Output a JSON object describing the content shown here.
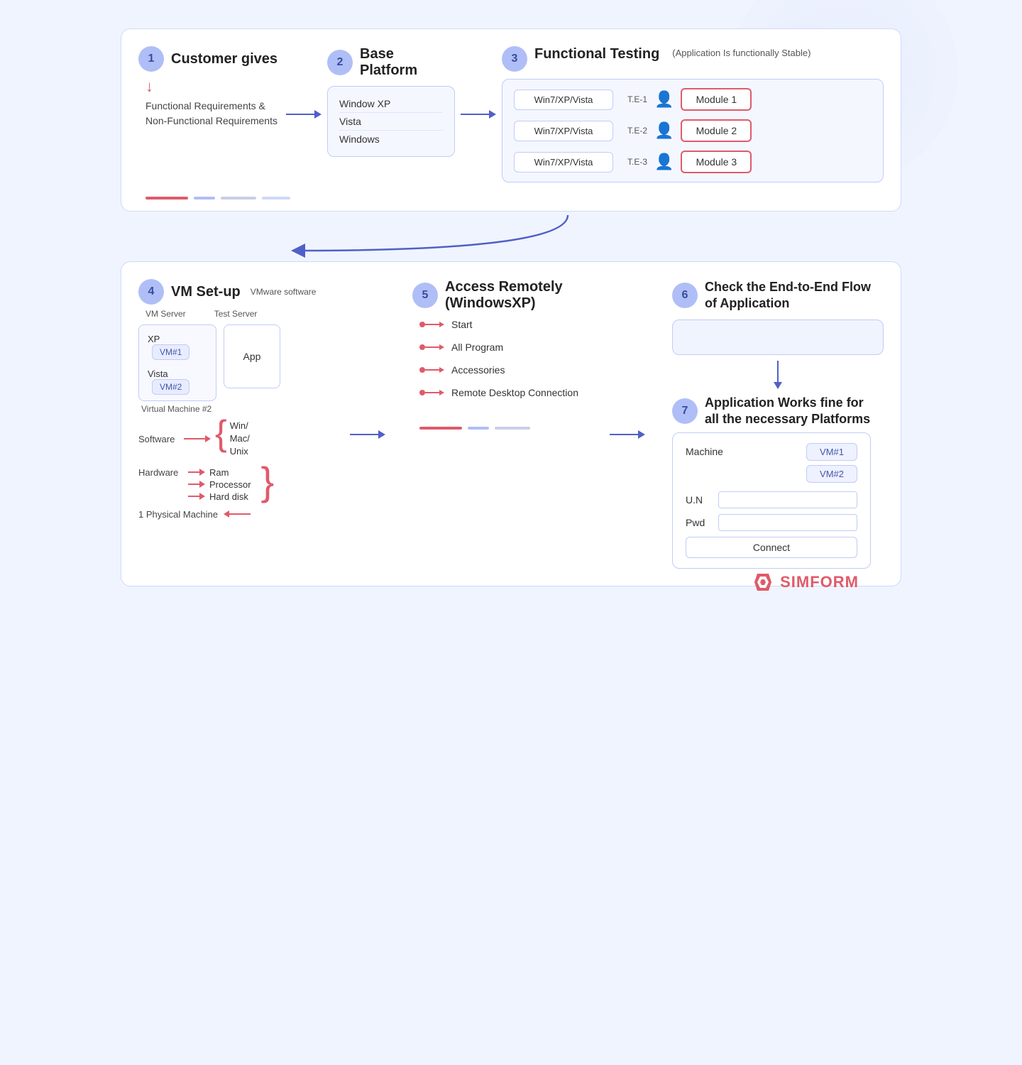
{
  "page": {
    "background_color": "#eef1fa"
  },
  "logo": {
    "text": "SIMFORM",
    "icon": "simform-icon"
  },
  "step1": {
    "number": "1",
    "title": "Customer gives",
    "down_arrow": "↓",
    "description": "Functional Requirements & Non-Functional Requirements"
  },
  "step2": {
    "number": "2",
    "title": "Base Platform",
    "items": [
      "Window XP",
      "Vista",
      "Windows"
    ]
  },
  "step3": {
    "number": "3",
    "title": "Functional Testing",
    "subtitle": "(Application Is functionally Stable)",
    "rows": [
      {
        "platform": "Win7/XP/Vista",
        "te": "T.E-1",
        "module": "Module 1"
      },
      {
        "platform": "Win7/XP/Vista",
        "te": "T.E-2",
        "module": "Module 2"
      },
      {
        "platform": "Win7/XP/Vista",
        "te": "T.E-3",
        "module": "Module 3"
      }
    ]
  },
  "step4": {
    "number": "4",
    "title": "VM Set-up",
    "vmware_label": "VMware software",
    "vm_server_label": "VM Server",
    "test_server_label": "Test Server",
    "vms": [
      {
        "os": "XP",
        "badge": "VM#1"
      },
      {
        "os": "Vista",
        "badge": "VM#2"
      }
    ],
    "test_server_content": "App",
    "vm2_label": "Virtual Machine #2",
    "software_label": "Software",
    "software_arrow": "→",
    "software_values": "Win/\nMac/\nUnix",
    "hardware_label": "Hardware",
    "hardware_items": [
      "Ram",
      "Processor",
      "Hard disk"
    ],
    "phys_machine": "1 Physical Machine"
  },
  "step5": {
    "number": "5",
    "title": "Access Remotely (WindowsXP)",
    "items": [
      "Start",
      "All Program",
      "Accessories",
      "Remote Desktop Connection"
    ]
  },
  "step6": {
    "number": "6",
    "title": "Check the End-to-End Flow of Application"
  },
  "step7": {
    "number": "7",
    "title": "Application Works fine for all the necessary Platforms",
    "machine_label": "Machine",
    "vms": [
      "VM#1",
      "VM#2"
    ],
    "un_label": "U.N",
    "pwd_label": "Pwd",
    "connect_btn": "Connect"
  },
  "deco": {
    "lines_top": [
      "red",
      "blue",
      "gray",
      "blue2"
    ],
    "lines_bottom": [
      "red",
      "blue",
      "gray"
    ]
  }
}
